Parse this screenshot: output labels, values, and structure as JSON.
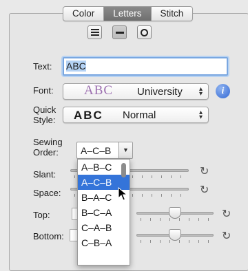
{
  "tabs": [
    {
      "label": "Color",
      "selected": false
    },
    {
      "label": "Letters",
      "selected": true
    },
    {
      "label": "Stitch",
      "selected": false
    }
  ],
  "view_modes": [
    {
      "icon": "lines-icon",
      "active": false
    },
    {
      "icon": "bar-icon",
      "active": true
    },
    {
      "icon": "circle-icon",
      "active": false
    }
  ],
  "text": {
    "label": "Text:",
    "value": "ABC"
  },
  "font": {
    "label": "Font:",
    "preview": "ABC",
    "name": "University",
    "preview_color": "#9c6fb0"
  },
  "quick_style": {
    "label_line1": "Quick",
    "label_line2": "Style:",
    "preview": "ABC",
    "name": "Normal"
  },
  "sewing_order": {
    "label_line1": "Sewing",
    "label_line2": "Order:",
    "value": "A–C–B",
    "options": [
      "A–B–C",
      "A–C–B",
      "B–A–C",
      "B–C–A",
      "C–A–B",
      "C–B–A"
    ],
    "highlighted_index": 1
  },
  "sliders": {
    "slant": {
      "label": "Slant:"
    },
    "space": {
      "label": "Space:"
    },
    "top": {
      "label": "Top:",
      "value_fraction": 0.5
    },
    "bottom": {
      "label": "Bottom:",
      "value_fraction": 0.5
    }
  },
  "icons": {
    "info": "info-icon",
    "reset": "reset-icon"
  },
  "colors": {
    "accent": "#3474d9",
    "info": "#3469d4",
    "selected_tab": "#7a7a7a"
  }
}
